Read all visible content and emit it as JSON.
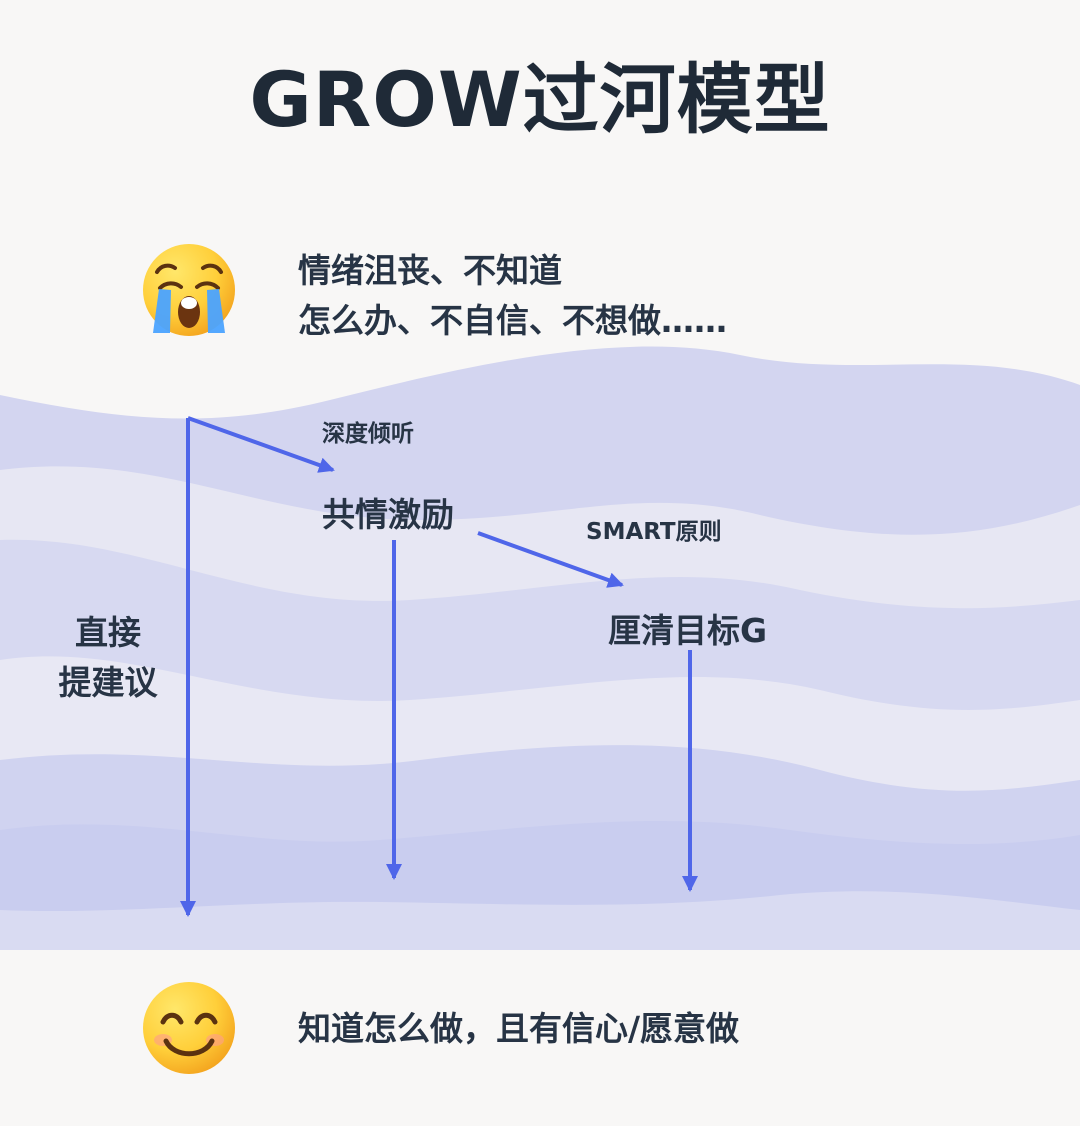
{
  "title": "GROW过河模型",
  "start": {
    "emoji": "crying-face-icon",
    "lines": [
      "情绪沮丧、不知道",
      "怎么办、不自信、不想做……"
    ]
  },
  "steps": [
    {
      "label": "共情激励"
    },
    {
      "label": "厘清目标G"
    }
  ],
  "transitions": [
    {
      "label": "深度倾听"
    },
    {
      "label": "SMART原则"
    }
  ],
  "left_label": {
    "lines": [
      "直接",
      "提建议"
    ]
  },
  "end": {
    "emoji": "smiling-face-icon",
    "text": "知道怎么做，且有信心/愿意做"
  },
  "colors": {
    "background": "#f8f7f6",
    "river_light": "#e7e7f3",
    "river_mid": "#d3d5f0",
    "river_dark": "#c4c8ee",
    "arrow": "#4f66e9",
    "text": "#273445"
  }
}
